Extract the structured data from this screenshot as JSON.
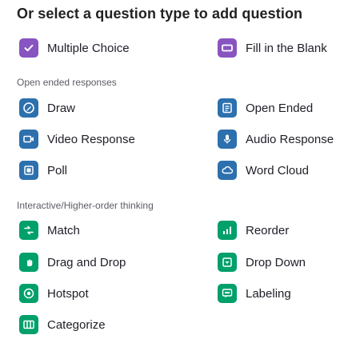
{
  "header": {
    "title": "Or select a question type to add question"
  },
  "colors": {
    "purple": "#8854c0",
    "blue": "#2d70ae",
    "green": "#00a06a"
  },
  "top_items": [
    {
      "label": "Multiple Choice",
      "icon": "checkbox-icon",
      "color": "#8854c0"
    },
    {
      "label": "Fill in the Blank",
      "icon": "blank-box-icon",
      "color": "#8854c0"
    }
  ],
  "open_ended": {
    "heading": "Open ended responses",
    "items": [
      {
        "label": "Draw",
        "icon": "draw-icon",
        "color": "#2d70ae"
      },
      {
        "label": "Open Ended",
        "icon": "text-lines-icon",
        "color": "#2d70ae"
      },
      {
        "label": "Video Response",
        "icon": "video-icon",
        "color": "#2d70ae"
      },
      {
        "label": "Audio Response",
        "icon": "microphone-icon",
        "color": "#2d70ae"
      },
      {
        "label": "Poll",
        "icon": "poll-icon",
        "color": "#2d70ae"
      },
      {
        "label": "Word Cloud",
        "icon": "cloud-icon",
        "color": "#2d70ae"
      }
    ]
  },
  "interactive": {
    "heading": "Interactive/Higher-order thinking",
    "items": [
      {
        "label": "Match",
        "icon": "match-icon",
        "color": "#00a06a"
      },
      {
        "label": "Reorder",
        "icon": "reorder-bars-icon",
        "color": "#00a06a"
      },
      {
        "label": "Drag and Drop",
        "icon": "drag-drop-icon",
        "color": "#00a06a"
      },
      {
        "label": "Drop Down",
        "icon": "dropdown-icon",
        "color": "#00a06a"
      },
      {
        "label": "Hotspot",
        "icon": "hotspot-icon",
        "color": "#00a06a"
      },
      {
        "label": "Labeling",
        "icon": "labeling-icon",
        "color": "#00a06a"
      },
      {
        "label": "Categorize",
        "icon": "categorize-icon",
        "color": "#00a06a"
      }
    ]
  }
}
